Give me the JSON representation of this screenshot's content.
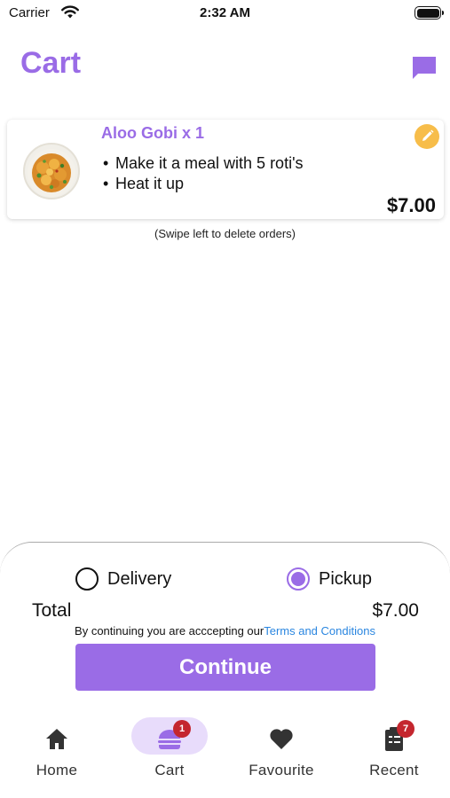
{
  "status_bar": {
    "carrier": "Carrier",
    "time": "2:32 AM"
  },
  "header": {
    "title": "Cart"
  },
  "order": {
    "title": "Aloo Gobi x 1",
    "options": [
      "Make it a meal with 5 roti's",
      "Heat it up"
    ],
    "bullet": "•",
    "price": "$7.00"
  },
  "swipe_hint": "(Swipe left to delete orders)",
  "checkout": {
    "delivery_label": "Delivery",
    "pickup_label": "Pickup",
    "selected": "Pickup",
    "total_label": "Total",
    "total_value": "$7.00",
    "terms_prefix": "By continuing you are acccepting our",
    "terms_link": "Terms and Conditions",
    "continue_label": "Continue"
  },
  "tabs": [
    {
      "label": "Home",
      "icon": "home-icon"
    },
    {
      "label": "Cart",
      "icon": "burger-icon",
      "badge": "1",
      "active": true
    },
    {
      "label": "Favourite",
      "icon": "heart-icon"
    },
    {
      "label": "Recent",
      "icon": "clipboard-icon",
      "badge": "7"
    }
  ],
  "colors": {
    "accent": "#9a6ce6",
    "edit": "#f7bd4a",
    "badge": "#c4262e",
    "link": "#2a86e0"
  }
}
